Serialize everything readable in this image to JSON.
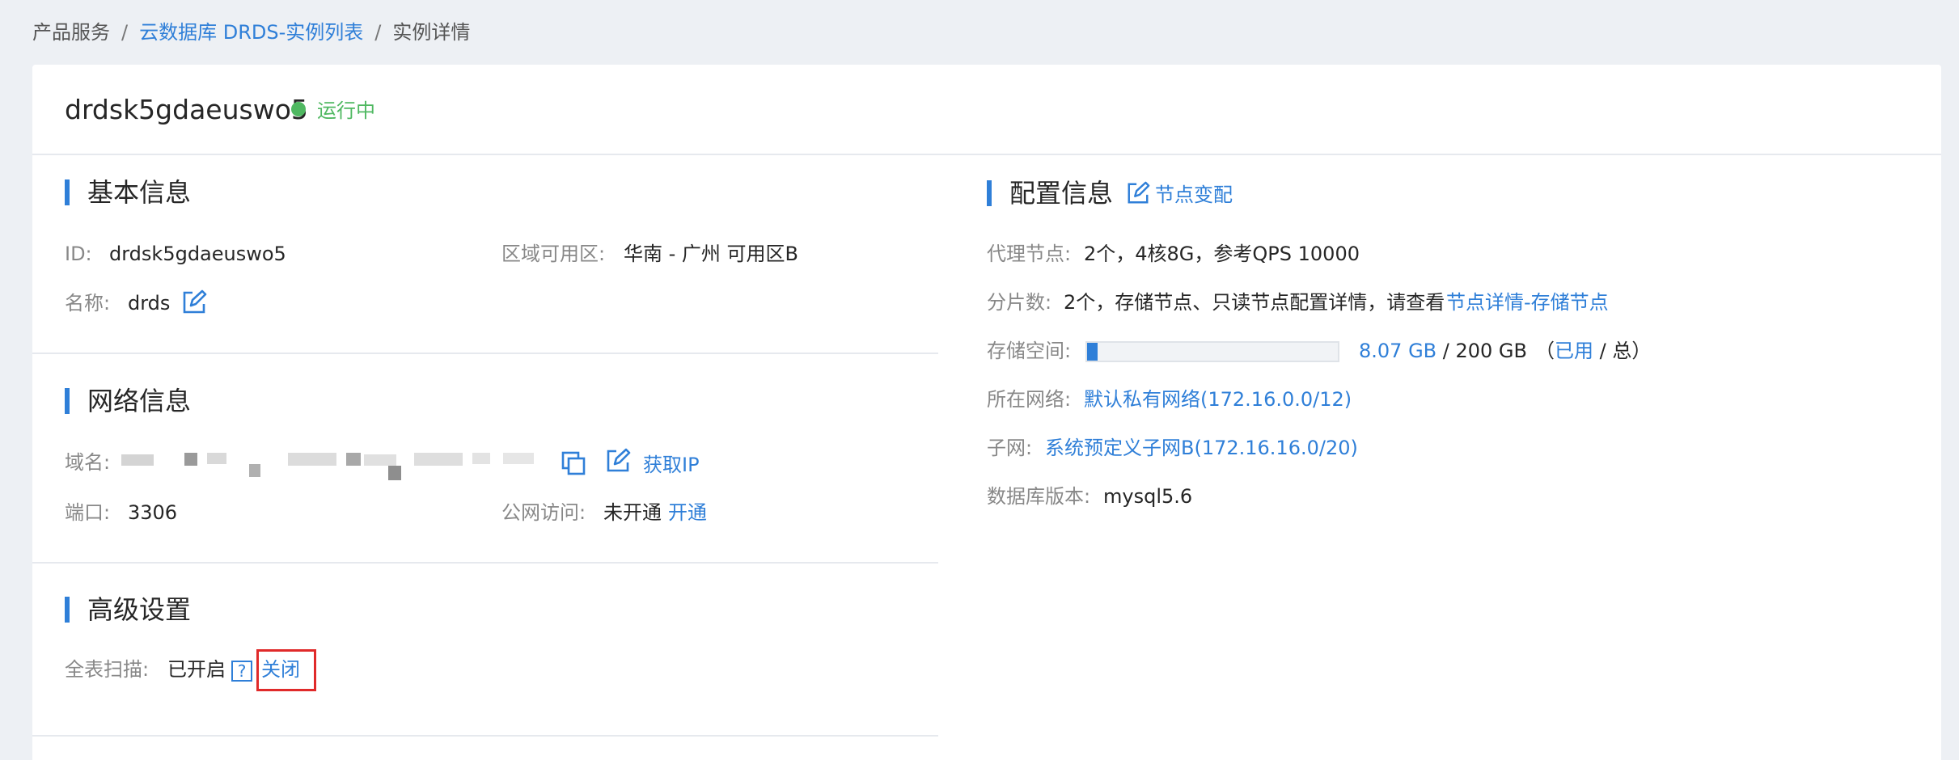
{
  "breadcrumb": {
    "root": "产品服务",
    "list": "云数据库 DRDS-实例列表",
    "current": "实例详情",
    "separator": "/"
  },
  "instance": {
    "name": "drdsk5gdaeuswo5",
    "status": "运行中",
    "status_color": "#4fb861"
  },
  "basic": {
    "title": "基本信息",
    "id_label": "ID:",
    "id_value": "drdsk5gdaeuswo5",
    "zone_label": "区域可用区:",
    "zone_value": "华南 - 广州 可用区B",
    "name_label": "名称:",
    "name_value": "drds"
  },
  "network": {
    "title": "网络信息",
    "domain_label": "域名:",
    "get_ip": "获取IP",
    "port_label": "端口:",
    "port_value": "3306",
    "public_label": "公网访问:",
    "public_value": "未开通",
    "enable": "开通"
  },
  "advanced": {
    "title": "高级设置",
    "scan_label": "全表扫描:",
    "scan_value": "已开启",
    "help": "?",
    "close": "关闭"
  },
  "config": {
    "title": "配置信息",
    "node_change": "节点变配",
    "proxy_label": "代理节点:",
    "proxy_value": "2个，4核8G，参考QPS 10000",
    "shard_label": "分片数:",
    "shard_value": "2个，存储节点、只读节点配置详情，请查看",
    "shard_link": "节点详情-存储节点",
    "storage_label": "存储空间:",
    "storage_used": "8.07 GB",
    "storage_sep": " / ",
    "storage_total": "200 GB",
    "storage_legend_open": "（",
    "storage_legend_used": "已用",
    "storage_legend_rest": " / 总）",
    "storage_fraction": 0.04035,
    "network_label": "所在网络:",
    "network_value": "默认私有网络(172.16.0.0/12)",
    "subnet_label": "子网:",
    "subnet_value": "系统预定义子网B(172.16.16.0/20)",
    "db_version_label": "数据库版本:",
    "db_version_value": "mysql5.6"
  },
  "colors": {
    "accent": "#2f7fd8",
    "highlight": "#e02a2a"
  }
}
